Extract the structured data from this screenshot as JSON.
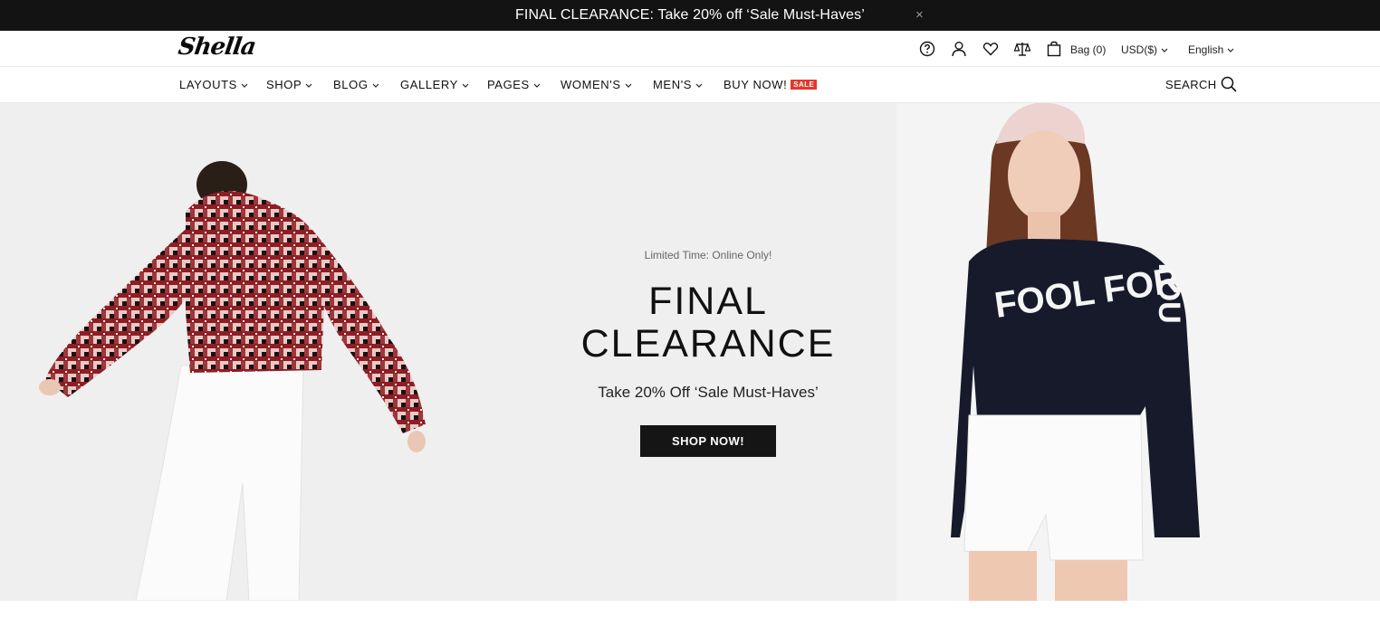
{
  "promo_bar": {
    "text": "FINAL CLEARANCE: Take 20% off ‘Sale Must-Haves’",
    "close_symbol": "×"
  },
  "header": {
    "logo": "Shella",
    "icons": [
      "help-icon",
      "account-icon",
      "wishlist-icon",
      "compare-icon",
      "bag-icon"
    ],
    "bag_label": "Bag (0)",
    "currency": "USD($)",
    "language": "English"
  },
  "nav": {
    "items": [
      {
        "label": "LAYOUTS"
      },
      {
        "label": "SHOP"
      },
      {
        "label": "BLOG"
      },
      {
        "label": "GALLERY"
      },
      {
        "label": "PAGES"
      },
      {
        "label": "WOMEN'S"
      },
      {
        "label": "MEN'S"
      },
      {
        "label": "BUY NOW!"
      }
    ],
    "sale_badge": "SALE",
    "search_label": "SEARCH"
  },
  "hero": {
    "eyebrow": "Limited Time: Online Only!",
    "title_line1": "FINAL",
    "title_line2": "CLEARANCE",
    "subtitle": "Take 20% Off ‘Sale Must-Haves’",
    "button": "SHOP NOW!",
    "right_sweater_text": "FOOL FOR YOU"
  },
  "colors": {
    "promo_bg": "#131313",
    "sale_badge": "#e4372b",
    "hero_bg": "#efefef",
    "button_bg": "#151515"
  }
}
